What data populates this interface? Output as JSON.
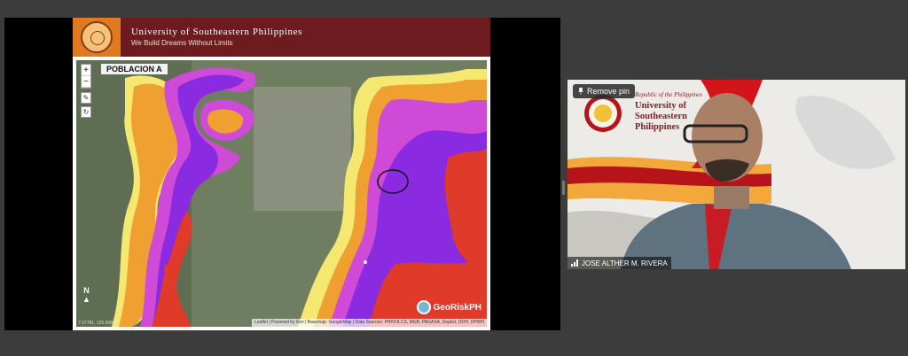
{
  "slide": {
    "university_name": "University of Southeastern Philippines",
    "tagline": "We Build Dreams Without Limits"
  },
  "map": {
    "title": "POBLACION A",
    "zoom_in": "+",
    "zoom_out": "−",
    "north_label": "N",
    "branding": "GeoRiskPH",
    "attribution": "Leaflet | Powered by Esri | Basemap: GoogleMap | Data Sources: PHIVOLCS, MGB, PAGASA, DepEd, DOH, DPWH",
    "coordinates": "7.07781, 125.60884"
  },
  "video": {
    "pin_label": "Remove pin",
    "banner_republic": "Republic of the Philippines",
    "banner_university": "University of Southeastern Philippines",
    "participant_name": "JOSE ALTHER M. RIVERA"
  },
  "colors": {
    "slide_header": "#6e1b1f",
    "seal_box": "#e07a1f",
    "hazard_purple": "#8a2be2",
    "hazard_magenta": "#d04ad8",
    "hazard_red": "#e03a2a",
    "hazard_orange": "#f0a030",
    "hazard_yellow": "#f4e870"
  },
  "icons": [
    "pin-icon",
    "pencil-icon",
    "reload-icon",
    "north-arrow-icon",
    "signal-icon"
  ]
}
